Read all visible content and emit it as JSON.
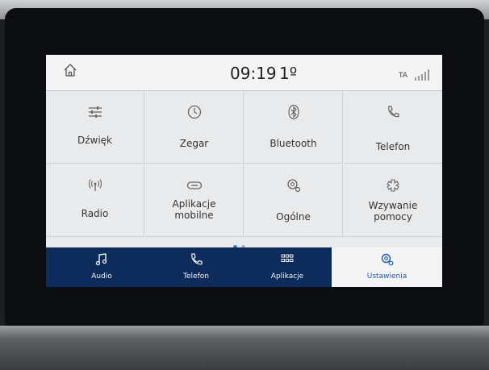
{
  "status": {
    "time": "09:19",
    "temperature": "1º",
    "ta": "TA"
  },
  "tiles": [
    {
      "label": "Dźwięk",
      "icon": "sliders-icon"
    },
    {
      "label": "Zegar",
      "icon": "clock-icon"
    },
    {
      "label": "Bluetooth",
      "icon": "bluetooth-icon"
    },
    {
      "label": "Telefon",
      "icon": "phone-icon"
    },
    {
      "label": "Radio",
      "icon": "radio-antenna-icon"
    },
    {
      "label": "Aplikacje\nmobilne",
      "icon": "link-icon"
    },
    {
      "label": "Ogólne",
      "icon": "gear-icon"
    },
    {
      "label": "Wzywanie\npomocy",
      "icon": "emergency-icon"
    }
  ],
  "nav": [
    {
      "label": "Audio",
      "icon": "music-note-icon"
    },
    {
      "label": "Telefon",
      "icon": "phone-icon"
    },
    {
      "label": "Aplikacje",
      "icon": "apps-grid-icon"
    },
    {
      "label": "Ustawienia",
      "icon": "settings-icon",
      "active": true
    }
  ],
  "colors": {
    "accent": "#1a5aa8",
    "navbar": "#0d2c5b",
    "dot_active": "#2f7fd1",
    "dot_inactive": "#9fb4cc"
  }
}
